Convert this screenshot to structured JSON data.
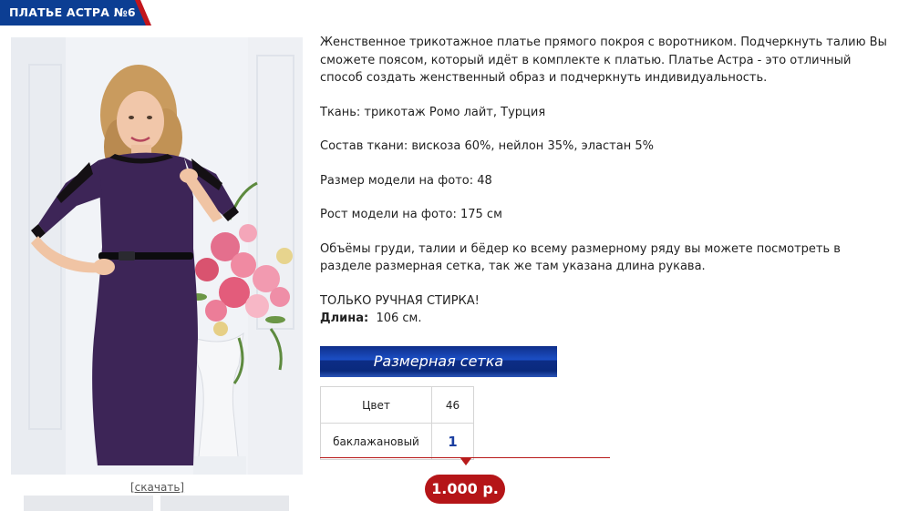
{
  "product": {
    "title": "ПЛАТЬЕ АСТРА №6",
    "download_label": "[скачать]",
    "description": [
      "Женственное трикотажное платье прямого покроя с воротником. Подчеркнуть талию Вы сможете поясом, который идёт в комплекте к платью. Платье Астра - это отличный способ создать женственный образ и подчеркнуть индивидуальность.",
      "Ткань: трикотаж Ромо лайт, Турция",
      "Состав ткани: вискоза 60%, нейлон 35%, эластан 5%",
      "Размер модели на фото: 48",
      "Рост модели на фото: 175 см",
      "Объёмы груди, талии и бёдер ко всему размерному ряду вы можете посмотреть в разделе размерная сетка, так же там указана длина рукава.",
      "ТОЛЬКО РУЧНАЯ СТИРКА!"
    ],
    "length_label": "Длина:",
    "length_value": "106 см.",
    "size_chart_button": "Размерная сетка",
    "table": {
      "header": [
        "Цвет",
        "46"
      ],
      "rows": [
        [
          "баклажановый",
          "1"
        ]
      ]
    },
    "price": "1.000 р."
  },
  "colors": {
    "brand_blue": "#0c3e93",
    "accent_red": "#c3161c",
    "dress_purple": "#3d2557"
  }
}
